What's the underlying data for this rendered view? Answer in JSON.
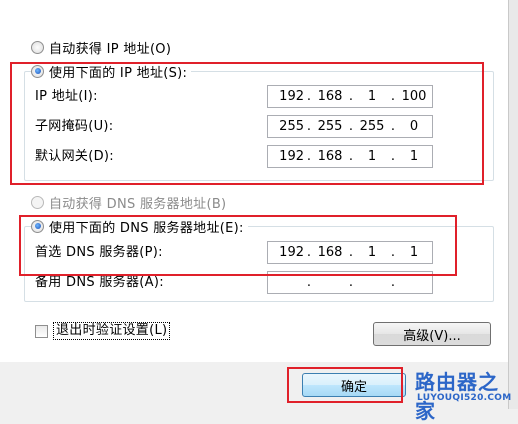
{
  "ip_section": {
    "auto_label": "自动获得 IP 地址(O)",
    "manual_label": "使用下面的 IP 地址(S):",
    "fields": [
      {
        "label": "IP 地址(I):",
        "octets": [
          "192",
          "168",
          "1",
          "100"
        ]
      },
      {
        "label": "子网掩码(U):",
        "octets": [
          "255",
          "255",
          "255",
          "0"
        ]
      },
      {
        "label": "默认网关(D):",
        "octets": [
          "192",
          "168",
          "1",
          "1"
        ]
      }
    ]
  },
  "dns_section": {
    "auto_label": "自动获得 DNS 服务器地址(B)",
    "manual_label": "使用下面的 DNS 服务器地址(E):",
    "fields": [
      {
        "label": "首选 DNS 服务器(P):",
        "octets": [
          "192",
          "168",
          "1",
          "1"
        ]
      },
      {
        "label": "备用 DNS 服务器(A):",
        "octets": [
          "",
          "",
          "",
          ""
        ]
      }
    ]
  },
  "validate_checkbox": {
    "label": "退出时验证设置(L)",
    "checked": false
  },
  "buttons": {
    "advanced": "高级(V)...",
    "ok": "确定"
  },
  "watermark": {
    "main": "路由器之家",
    "sub": "LUYOUQI520.COM"
  },
  "colors": {
    "highlight_border": "#e0202a",
    "watermark": "#2c66c8"
  }
}
